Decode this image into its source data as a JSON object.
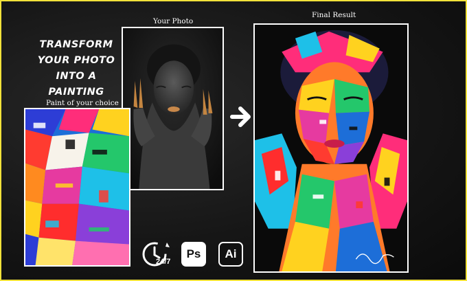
{
  "headline": {
    "line1": "Transform",
    "line2": "your photo",
    "line3": "into a painting"
  },
  "captions": {
    "paint": "Paint of your choice",
    "photo": "Your Photo",
    "result": "Final Result"
  },
  "badges": {
    "support": "24/7",
    "photoshop": "Ps",
    "illustrator": "Ai"
  },
  "colors": {
    "border": "#f2e23a",
    "background": "#161616",
    "frame": "#ffffff"
  },
  "icons": [
    "clock-icon",
    "arrow-right-icon",
    "photoshop-icon",
    "illustrator-icon"
  ]
}
